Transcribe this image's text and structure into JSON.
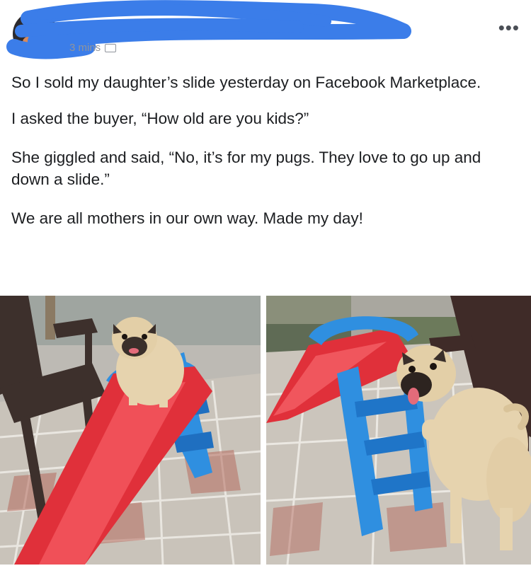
{
  "header": {
    "meta_text": "3 mins",
    "more_icon": "ellipsis-icon",
    "globe_icon": "audience-icon",
    "redaction_color": "#3b7de9"
  },
  "post": {
    "paragraphs": [
      "So I sold my daughter’s slide yesterday on Facebook Marketplace.",
      "I asked the buyer, “How old are you kids?”",
      "She giggled and said, “No, it’s for my pugs. They love to go up and down a slide.”",
      "We are all mothers in our own way. Made my day!"
    ]
  },
  "colors": {
    "text": "#1c1e21",
    "slide_red": "#e0303a",
    "slide_blue": "#2f8fe0",
    "pug": "#e6d3ae"
  }
}
